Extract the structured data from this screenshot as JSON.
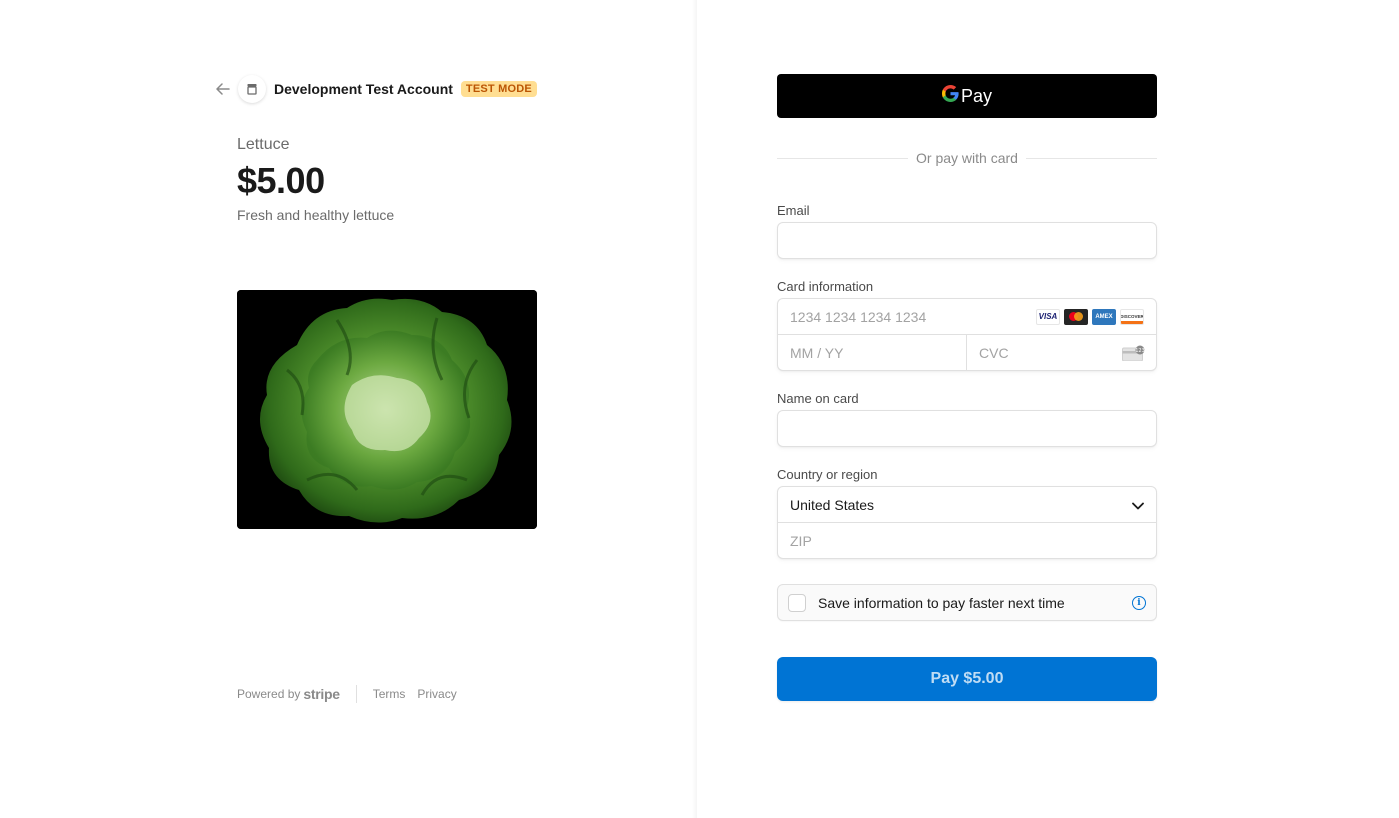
{
  "header": {
    "merchant_name": "Development Test Account",
    "test_mode_badge": "TEST MODE"
  },
  "product": {
    "name": "Lettuce",
    "price": "$5.00",
    "description": "Fresh and healthy lettuce",
    "image_icon": "lettuce-image"
  },
  "footer": {
    "powered_by": "Powered by",
    "stripe": "stripe",
    "terms": "Terms",
    "privacy": "Privacy"
  },
  "payment": {
    "gpay_label": "Pay",
    "divider_text": "Or pay with card",
    "email_label": "Email",
    "email_value": "",
    "card_label": "Card information",
    "card_number_placeholder": "1234 1234 1234 1234",
    "card_brands": [
      "VISA",
      "mastercard",
      "AMEX",
      "DISCOVER"
    ],
    "expiry_placeholder": "MM / YY",
    "cvc_placeholder": "CVC",
    "name_label": "Name on card",
    "name_value": "",
    "country_label": "Country or region",
    "country_value": "United States",
    "zip_placeholder": "ZIP",
    "save_info_text": "Save information to pay faster next time",
    "save_info_checked": false,
    "pay_button_label": "Pay $5.00"
  },
  "colors": {
    "accent": "#0074d4",
    "badge_bg": "#ffde92",
    "badge_text": "#bb5504"
  }
}
